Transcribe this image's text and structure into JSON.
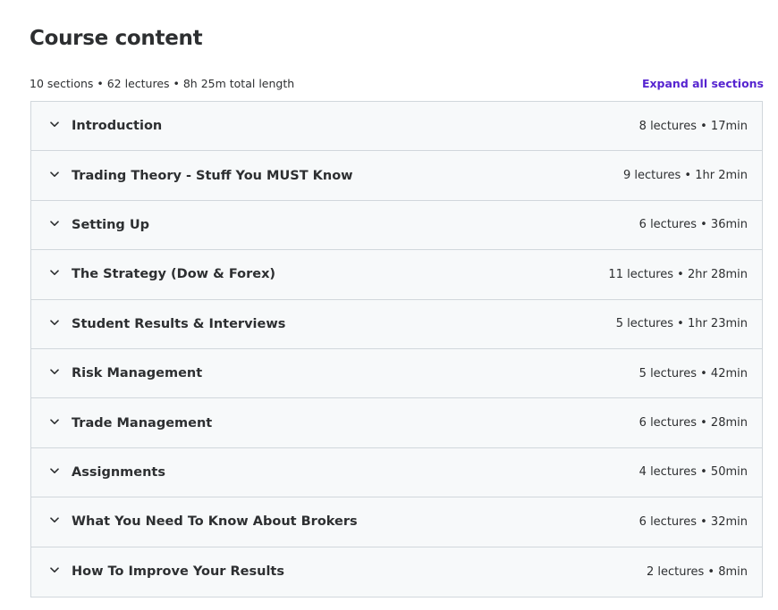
{
  "header": {
    "title": "Course content",
    "summary": "10 sections • 62 lectures • 8h 25m total length",
    "expand_label": "Expand all sections"
  },
  "colors": {
    "accent": "#5624d0",
    "row_bg": "#f7f9fa",
    "border": "#d1d7dc",
    "text": "#2d2f31"
  },
  "sections": [
    {
      "title": "Introduction",
      "meta": "8 lectures • 17min",
      "icon": "chevron-down-icon"
    },
    {
      "title": "Trading Theory - Stuff You MUST Know",
      "meta": "9 lectures • 1hr 2min",
      "icon": "chevron-down-icon"
    },
    {
      "title": "Setting Up",
      "meta": "6 lectures • 36min",
      "icon": "chevron-down-icon"
    },
    {
      "title": "The Strategy (Dow & Forex)",
      "meta": "11 lectures • 2hr 28min",
      "icon": "chevron-down-icon"
    },
    {
      "title": "Student Results & Interviews",
      "meta": "5 lectures • 1hr 23min",
      "icon": "chevron-down-icon"
    },
    {
      "title": "Risk Management",
      "meta": "5 lectures • 42min",
      "icon": "chevron-down-icon"
    },
    {
      "title": "Trade Management",
      "meta": "6 lectures • 28min",
      "icon": "chevron-down-icon"
    },
    {
      "title": "Assignments",
      "meta": "4 lectures • 50min",
      "icon": "chevron-down-icon"
    },
    {
      "title": "What You Need To Know About Brokers",
      "meta": "6 lectures • 32min",
      "icon": "chevron-down-icon"
    },
    {
      "title": "How To Improve Your Results",
      "meta": "2 lectures • 8min",
      "icon": "chevron-down-icon"
    }
  ]
}
